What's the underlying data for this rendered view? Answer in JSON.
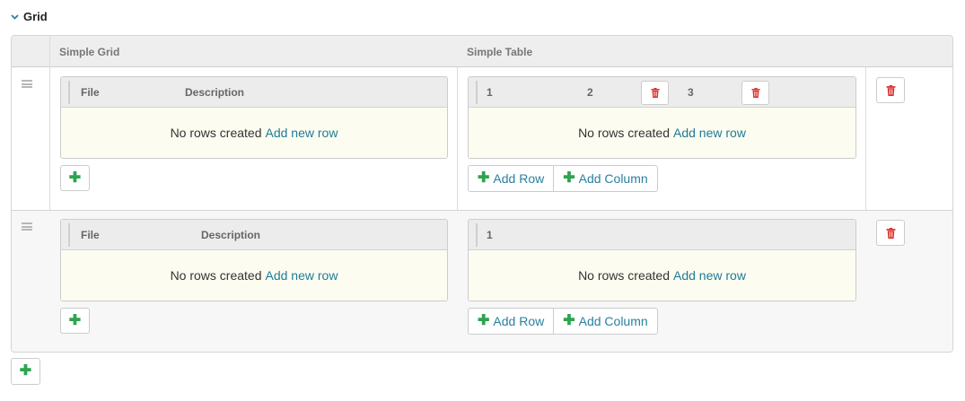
{
  "section": {
    "title": "Grid",
    "icon": "chevron-down-icon"
  },
  "columns": {
    "simple_grid": "Simple Grid",
    "simple_table": "Simple Table"
  },
  "rows": [
    {
      "grid": {
        "headers": [
          "File",
          "Description"
        ],
        "empty_text": "No rows created",
        "add_link": "Add new row"
      },
      "table": {
        "headers": [
          "1",
          "2",
          "3"
        ],
        "empty_text": "No rows created",
        "add_link": "Add new row"
      }
    },
    {
      "grid": {
        "headers": [
          "File",
          "Description"
        ],
        "empty_text": "No rows created",
        "add_link": "Add new row"
      },
      "table": {
        "headers": [
          "1"
        ],
        "empty_text": "No rows created",
        "add_link": "Add new row"
      }
    }
  ],
  "buttons": {
    "add_row": "Add Row",
    "add_column": "Add Column"
  },
  "colors": {
    "accent_link": "#1f7a9a",
    "add_green": "#2ea44f",
    "delete_red": "#d9302c",
    "empty_body": "#fcfdf0"
  }
}
